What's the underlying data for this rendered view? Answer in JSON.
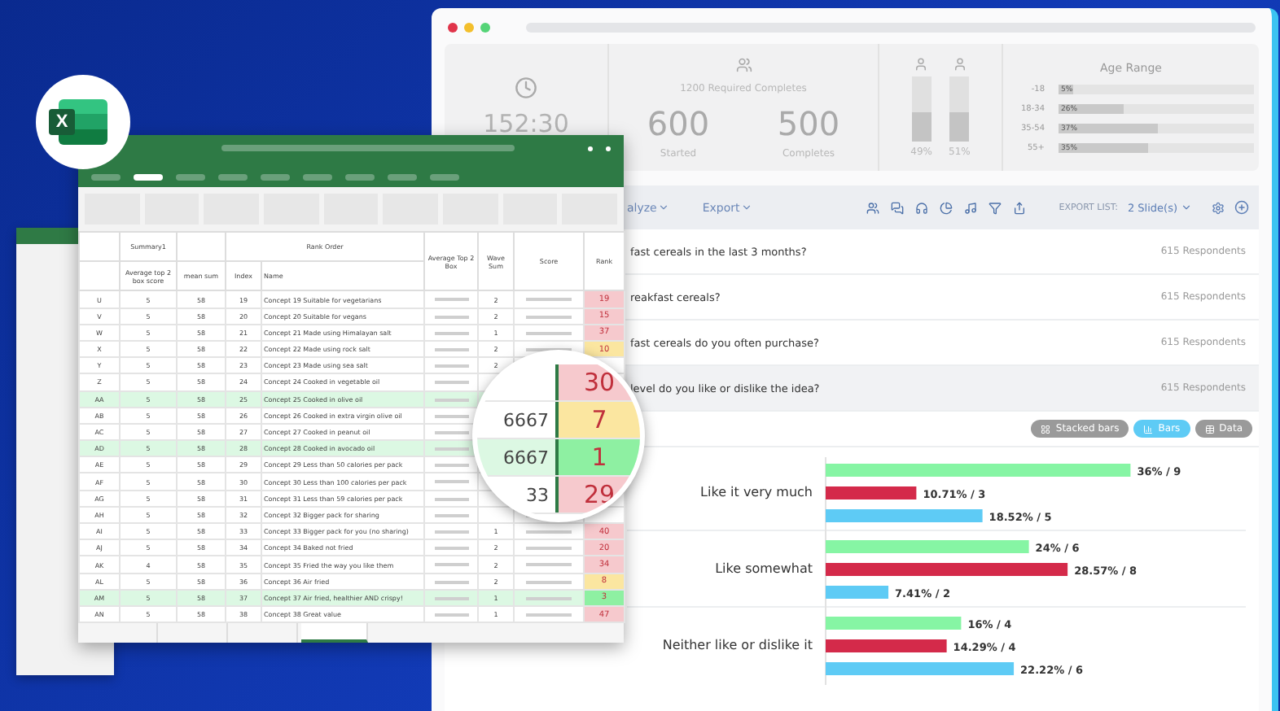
{
  "dashboard": {
    "timer": "152:30",
    "required": "1200 Required Completes",
    "counts": [
      {
        "value": "600",
        "label": "Started"
      },
      {
        "value": "500",
        "label": "Completes"
      }
    ],
    "gender": [
      {
        "level": 0.49,
        "label": "49%"
      },
      {
        "level": 0.51,
        "label": "51%"
      }
    ],
    "age_range": {
      "title": "Age Range",
      "rows": [
        {
          "label": "-18",
          "value": "5%",
          "level": 0.08
        },
        {
          "label": "18-34",
          "value": "26%",
          "level": 0.34
        },
        {
          "label": "35-54",
          "value": "37%",
          "level": 0.51
        },
        {
          "label": "55+",
          "value": "35%",
          "level": 0.46
        }
      ]
    },
    "toolbar": {
      "menus": [
        "alyze",
        "Export"
      ],
      "export_list_label": "EXPORT LIST:",
      "export_list_value": "2 Slide(s)"
    },
    "questions": [
      {
        "text": "fast cereals in the last 3 months?",
        "respondents": "615 Respondents",
        "selected": false
      },
      {
        "text": "reakfast cereals?",
        "respondents": "615 Respondents",
        "selected": false
      },
      {
        "text": "fast cereals do you often purchase?",
        "respondents": "615 Respondents",
        "selected": false
      },
      {
        "text": "level do you like or dislike the idea?",
        "respondents": "615 Respondents",
        "selected": true
      }
    ],
    "view_buttons": [
      {
        "label": "Stacked bars",
        "kind": "stacked",
        "selected": false
      },
      {
        "label": "Bars",
        "kind": "bars",
        "selected": true
      },
      {
        "label": "Data",
        "kind": "data",
        "selected": false
      }
    ],
    "chart_data": {
      "type": "bar",
      "orientation": "horizontal",
      "categories": [
        "Like it very much",
        "Like somewhat",
        "Neither like or dislike it"
      ],
      "series": [
        {
          "color": "#86f5a4",
          "values": [
            36,
            24,
            16
          ],
          "value_labels": [
            "36% / 9",
            "24% / 6",
            "16% / 4"
          ]
        },
        {
          "color": "#d42a4a",
          "values": [
            10.71,
            28.57,
            14.29
          ],
          "value_labels": [
            "10.71% / 3",
            "28.57% / 8",
            "14.29% / 4"
          ]
        },
        {
          "color": "#5ecbf5",
          "values": [
            18.52,
            7.41,
            22.22
          ],
          "value_labels": [
            "18.52% / 5",
            "7.41% / 2",
            "22.22% / 6"
          ]
        }
      ]
    }
  },
  "spreadsheet": {
    "logo_letter": "X",
    "headers": {
      "summary": "Summary1",
      "rank_order": "Rank Order",
      "avg": "Average top 2 box score",
      "mean_sum": "mean sum",
      "index": "Index",
      "name": "Name",
      "avg_top2": "Average Top 2 Box",
      "wave_sum": "Wave Sum",
      "score": "Score",
      "rank": "Rank"
    },
    "rows": [
      {
        "row": "U",
        "avg": "5",
        "mean_sum": "58",
        "index": "19",
        "name": "Concept 19 Suitable for vegetarians",
        "wave_sum": "2",
        "rank": "19",
        "color": "#f6c9cd",
        "highlighted": false
      },
      {
        "row": "V",
        "avg": "5",
        "mean_sum": "58",
        "index": "20",
        "name": "Concept 20 Suitable for vegans",
        "wave_sum": "2",
        "rank": "15",
        "color": "#f6c9cd",
        "highlighted": false
      },
      {
        "row": "W",
        "avg": "5",
        "mean_sum": "58",
        "index": "21",
        "name": "Concept 21 Made using Himalayan salt",
        "wave_sum": "1",
        "rank": "37",
        "color": "#f6c9cd",
        "highlighted": false
      },
      {
        "row": "X",
        "avg": "5",
        "mean_sum": "58",
        "index": "22",
        "name": "Concept 22 Made using rock salt",
        "wave_sum": "2",
        "rank": "10",
        "color": "#fbe6a0",
        "highlighted": false
      },
      {
        "row": "Y",
        "avg": "5",
        "mean_sum": "58",
        "index": "23",
        "name": "Concept 23 Made using sea salt",
        "wave_sum": "2",
        "highlighted": false
      },
      {
        "row": "Z",
        "avg": "5",
        "mean_sum": "58",
        "index": "24",
        "name": "Concept 24 Cooked in vegetable oil",
        "highlighted": false
      },
      {
        "row": "AA",
        "avg": "5",
        "mean_sum": "58",
        "index": "25",
        "name": "Concept 25 Cooked in olive oil",
        "highlighted": true
      },
      {
        "row": "AB",
        "avg": "5",
        "mean_sum": "58",
        "index": "26",
        "name": "Concept 26 Cooked in extra virgin olive oil",
        "highlighted": false
      },
      {
        "row": "AC",
        "avg": "5",
        "mean_sum": "58",
        "index": "27",
        "name": "Concept 27 Cooked in peanut oil",
        "highlighted": false
      },
      {
        "row": "AD",
        "avg": "5",
        "mean_sum": "58",
        "index": "28",
        "name": "Concept 28 Cooked in avocado oil",
        "highlighted": true
      },
      {
        "row": "AE",
        "avg": "5",
        "mean_sum": "58",
        "index": "29",
        "name": "Concept 29 Less than 50 calories per pack",
        "highlighted": false
      },
      {
        "row": "AF",
        "avg": "5",
        "mean_sum": "58",
        "index": "30",
        "name": "Concept 30 Less than 100 calories per pack",
        "highlighted": false
      },
      {
        "row": "AG",
        "avg": "5",
        "mean_sum": "58",
        "index": "31",
        "name": "Concept 31 Less than 59 calories per pack",
        "highlighted": false
      },
      {
        "row": "AH",
        "avg": "5",
        "mean_sum": "58",
        "index": "32",
        "name": "Concept 32 Bigger pack for sharing",
        "highlighted": false
      },
      {
        "row": "AI",
        "avg": "5",
        "mean_sum": "58",
        "index": "33",
        "name": "Concept 33 Bigger pack for you (no sharing)",
        "wave_sum": "1",
        "rank": "40",
        "color": "#f6c9cd",
        "highlighted": false
      },
      {
        "row": "AJ",
        "avg": "5",
        "mean_sum": "58",
        "index": "34",
        "name": "Concept 34 Baked not fried",
        "wave_sum": "2",
        "rank": "20",
        "color": "#f6c9cd",
        "highlighted": false
      },
      {
        "row": "AK",
        "avg": "4",
        "mean_sum": "58",
        "index": "35",
        "name": "Concept 35 Fried the way you like them",
        "wave_sum": "2",
        "rank": "34",
        "color": "#f6c9cd",
        "highlighted": false
      },
      {
        "row": "AL",
        "avg": "5",
        "mean_sum": "58",
        "index": "36",
        "name": "Concept 36 Air fried",
        "wave_sum": "2",
        "rank": "8",
        "color": "#fbe6a0",
        "highlighted": false
      },
      {
        "row": "AM",
        "avg": "5",
        "mean_sum": "58",
        "index": "37",
        "name": "Concept 37 Air fried, healthier AND crispy!",
        "wave_sum": "1",
        "rank": "3",
        "color": "#8ef0a2",
        "highlighted": true
      },
      {
        "row": "AN",
        "avg": "5",
        "mean_sum": "58",
        "index": "38",
        "name": "Concept 38 Great value",
        "wave_sum": "1",
        "rank": "47",
        "color": "#f6c9cd",
        "highlighted": false
      }
    ],
    "magnifier": [
      {
        "rank": "30",
        "color": "#f6c9cd",
        "highlighted": false
      },
      {
        "score": "6667",
        "rank": "7",
        "color": "#fbe6a0",
        "highlighted": false
      },
      {
        "score": "6667",
        "rank": "1",
        "color": "#8ef0a2",
        "highlighted": true
      },
      {
        "score": "33",
        "rank": "29",
        "color": "#f6c9cd",
        "highlighted": false
      }
    ]
  }
}
